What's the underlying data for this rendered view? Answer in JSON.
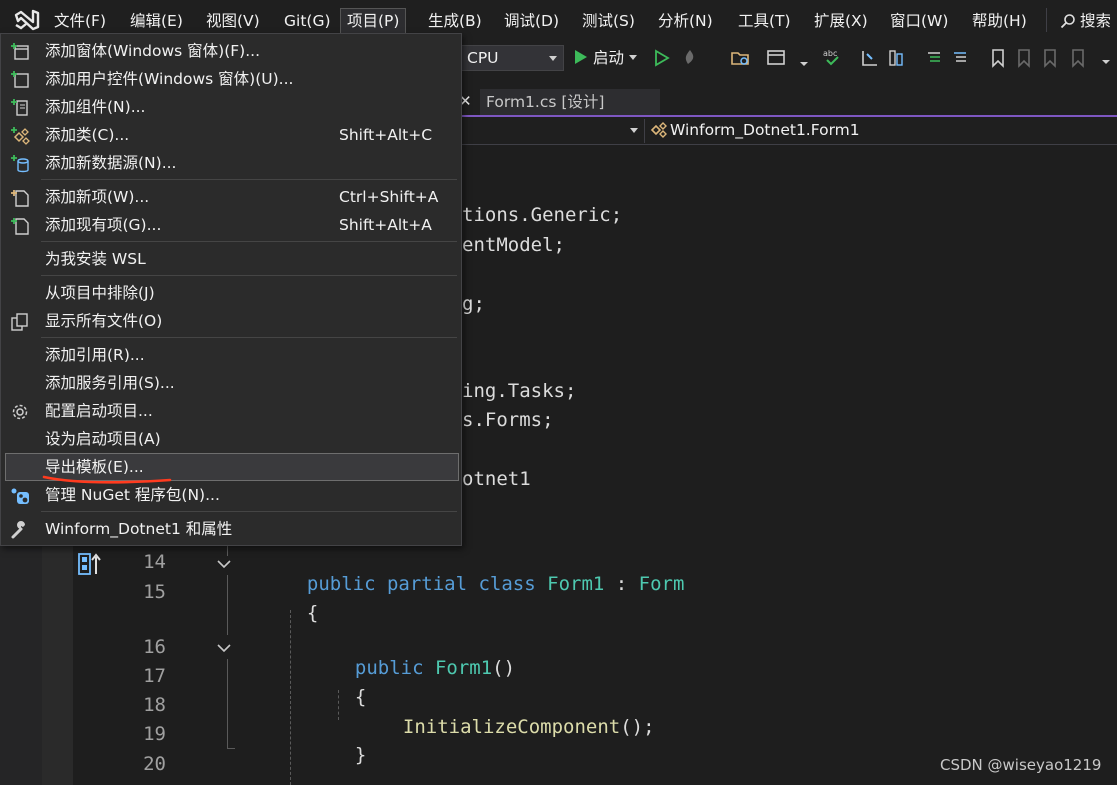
{
  "menubar": {
    "items": [
      "文件(F)",
      "编辑(E)",
      "视图(V)",
      "Git(G)",
      "项目(P)",
      "生成(B)",
      "调试(D)",
      "测试(S)",
      "分析(N)",
      "工具(T)",
      "扩展(X)",
      "窗口(W)",
      "帮助(H)"
    ],
    "active_item": "项目(P)",
    "search_label": "搜索"
  },
  "toolbar": {
    "platform_value": "CPU",
    "start_label": "启动"
  },
  "tabs": {
    "active_tab_label": "Form1.cs [设计]"
  },
  "navbar": {
    "class_selector_value": "Winform_Dotnet1.Form1"
  },
  "project_menu": {
    "items": [
      {
        "label": "添加窗体(Windows 窗体)(F)...",
        "shortcut": "",
        "icon": "add-form-icon"
      },
      {
        "label": "添加用户控件(Windows 窗体)(U)...",
        "shortcut": "",
        "icon": "add-user-control-icon"
      },
      {
        "label": "添加组件(N)...",
        "shortcut": "",
        "icon": "add-component-icon"
      },
      {
        "label": "添加类(C)...",
        "shortcut": "Shift+Alt+C",
        "icon": "add-class-icon"
      },
      {
        "label": "添加新数据源(N)...",
        "shortcut": "",
        "icon": "add-data-source-icon"
      },
      {
        "label": "添加新项(W)...",
        "shortcut": "Ctrl+Shift+A",
        "icon": "add-new-item-icon"
      },
      {
        "label": "添加现有项(G)...",
        "shortcut": "Shift+Alt+A",
        "icon": "add-existing-item-icon"
      },
      {
        "label": "为我安装 WSL",
        "shortcut": "",
        "icon": ""
      },
      {
        "label": "从项目中排除(J)",
        "shortcut": "",
        "icon": ""
      },
      {
        "label": "显示所有文件(O)",
        "shortcut": "",
        "icon": "show-all-files-icon"
      },
      {
        "label": "添加引用(R)...",
        "shortcut": "",
        "icon": ""
      },
      {
        "label": "添加服务引用(S)...",
        "shortcut": "",
        "icon": ""
      },
      {
        "label": "配置启动项目...",
        "shortcut": "",
        "icon": "gear-icon"
      },
      {
        "label": "设为启动项目(A)",
        "shortcut": "",
        "icon": ""
      },
      {
        "label": "导出模板(E)...",
        "shortcut": "",
        "icon": "",
        "highlighted": true
      },
      {
        "label": "管理 NuGet 程序包(N)...",
        "shortcut": "",
        "icon": "nuget-icon"
      },
      {
        "label": "Winform_Dotnet1 和属性",
        "shortcut": "",
        "icon": "wrench-icon"
      }
    ]
  },
  "code": {
    "visible_fragments": [
      {
        "line": "",
        "text": "tions.Generic;"
      },
      {
        "line": "",
        "text": "entModel;"
      },
      {
        "line": "",
        "text": "g;"
      },
      {
        "line": "",
        "text": "ing.Tasks;"
      },
      {
        "line": "",
        "text": "s.Forms;"
      },
      {
        "line": "",
        "text": "otnet1"
      }
    ],
    "lines": [
      {
        "number": "14",
        "tokens": [
          [
            "kw",
            "public "
          ],
          [
            "kw",
            "partial "
          ],
          [
            "kw",
            "class "
          ],
          [
            "ty",
            "Form1"
          ],
          [
            "tx",
            " : "
          ],
          [
            "ty",
            "Form"
          ]
        ]
      },
      {
        "number": "15",
        "tokens": [
          [
            "tx",
            "{"
          ]
        ]
      },
      {
        "number": "16",
        "tokens": [
          [
            "kw",
            "public "
          ],
          [
            "ty",
            "Form1"
          ],
          [
            "tx",
            "()"
          ]
        ]
      },
      {
        "number": "17",
        "tokens": [
          [
            "tx",
            "{"
          ]
        ]
      },
      {
        "number": "18",
        "tokens": [
          [
            "fn",
            "InitializeComponent"
          ],
          [
            "tx",
            "();"
          ]
        ]
      },
      {
        "number": "19",
        "tokens": [
          [
            "tx",
            "}"
          ]
        ]
      },
      {
        "number": "20",
        "tokens": []
      }
    ]
  },
  "colors": {
    "accent": "#7e57c2",
    "annotation_underline": "#ff3b1f",
    "keyword": "#569cd6",
    "type": "#4ec9b0",
    "method": "#dcdcaa"
  },
  "watermark": "CSDN @wiseyao1219"
}
